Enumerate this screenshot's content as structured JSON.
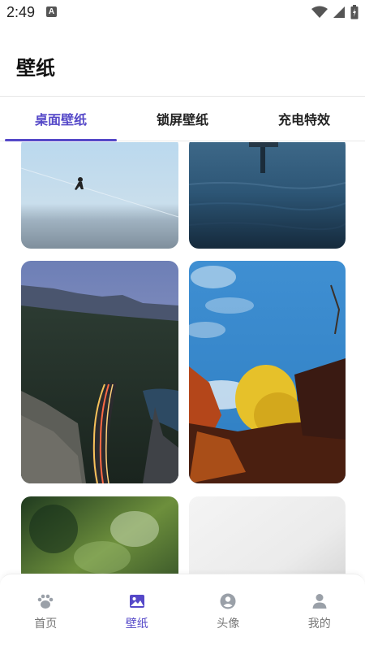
{
  "status_bar": {
    "time": "2:49",
    "notification_icon_letter": "A"
  },
  "header": {
    "title": "壁纸"
  },
  "tabs": [
    {
      "label": "桌面壁纸",
      "active": true
    },
    {
      "label": "锁屏壁纸",
      "active": false
    },
    {
      "label": "充电特效",
      "active": false
    }
  ],
  "wallpapers": [
    {
      "description_icon": "runner-sky-image"
    },
    {
      "description_icon": "water-reflection-image"
    },
    {
      "description_icon": "mountain-road-image"
    },
    {
      "description_icon": "yellow-tree-sky-image"
    },
    {
      "description_icon": "green-texture-image"
    },
    {
      "description_icon": "white-texture-image"
    }
  ],
  "bottom_nav": [
    {
      "label": "首页",
      "icon": "paw-icon",
      "active": false
    },
    {
      "label": "壁纸",
      "icon": "image-icon",
      "active": true
    },
    {
      "label": "头像",
      "icon": "avatar-circle-icon",
      "active": false
    },
    {
      "label": "我的",
      "icon": "person-icon",
      "active": false
    }
  ],
  "colors": {
    "accent": "#5548c8",
    "inactive": "#777777",
    "icon_inactive": "#9aa0a8"
  }
}
